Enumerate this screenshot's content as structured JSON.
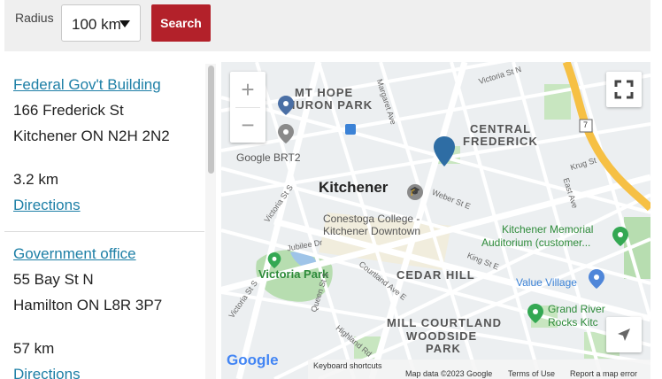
{
  "search": {
    "radius_label": "Radius",
    "radius_value": "100 km",
    "button_label": "Search"
  },
  "results": [
    {
      "name": "Federal Gov't Building",
      "address1": "166 Frederick St",
      "address2": "Kitchener ON N2H 2N2",
      "distance": "3.2 km",
      "directions": "Directions"
    },
    {
      "name": "Government office",
      "address1": "55 Bay St N",
      "address2": "Hamilton ON L8R 3P7",
      "distance": "57 km",
      "directions": "Directions"
    }
  ],
  "map": {
    "zoom_in": "+",
    "zoom_out": "−",
    "city_label": "Kitchener",
    "districts": {
      "mt_hope": "MT HOPE",
      "huron_park": "HURON PARK",
      "central": "CENTRAL",
      "frederick": "FREDERICK",
      "cedar_hill": "CEDAR HILL",
      "mill_courtland": "MILL COURTLAND",
      "woodside": "WOODSIDE",
      "park": "PARK"
    },
    "pois": {
      "google_brt2": "Google BRT2",
      "conestoga_1": "Conestoga College -",
      "conestoga_2": "Kitchener Downtown",
      "victoria_park": "Victoria Park",
      "memorial_1": "Kitchener Memorial",
      "memorial_2": "Auditorium (customer...",
      "value_village": "Value Village",
      "grand_river_1": "Grand River",
      "grand_river_2": "Rocks Kitc"
    },
    "streets": {
      "margaret": "Margaret Ave",
      "victoria_n": "Victoria St N",
      "victoria_s1": "Victoria St S",
      "victoria_s2": "Victoria St S",
      "weber": "Weber St E",
      "krug": "Krug St",
      "east": "East Ave",
      "king": "King St E",
      "queen": "Queen St S",
      "jubilee": "Jubilee Dr",
      "courtland": "Courtland Ave E",
      "highland": "Highland Rd",
      "hwy": "7"
    },
    "footer": {
      "logo": "Google",
      "keyboard": "Keyboard shortcuts",
      "mapdata": "Map data ©2023 Google",
      "terms": "Terms of Use",
      "report": "Report a map error"
    },
    "colors": {
      "marker": "#2e6da4",
      "park": "#b7ddb0",
      "highway": "#f6c044",
      "search_button": "#b3212a",
      "link": "#1d7fa6"
    }
  }
}
